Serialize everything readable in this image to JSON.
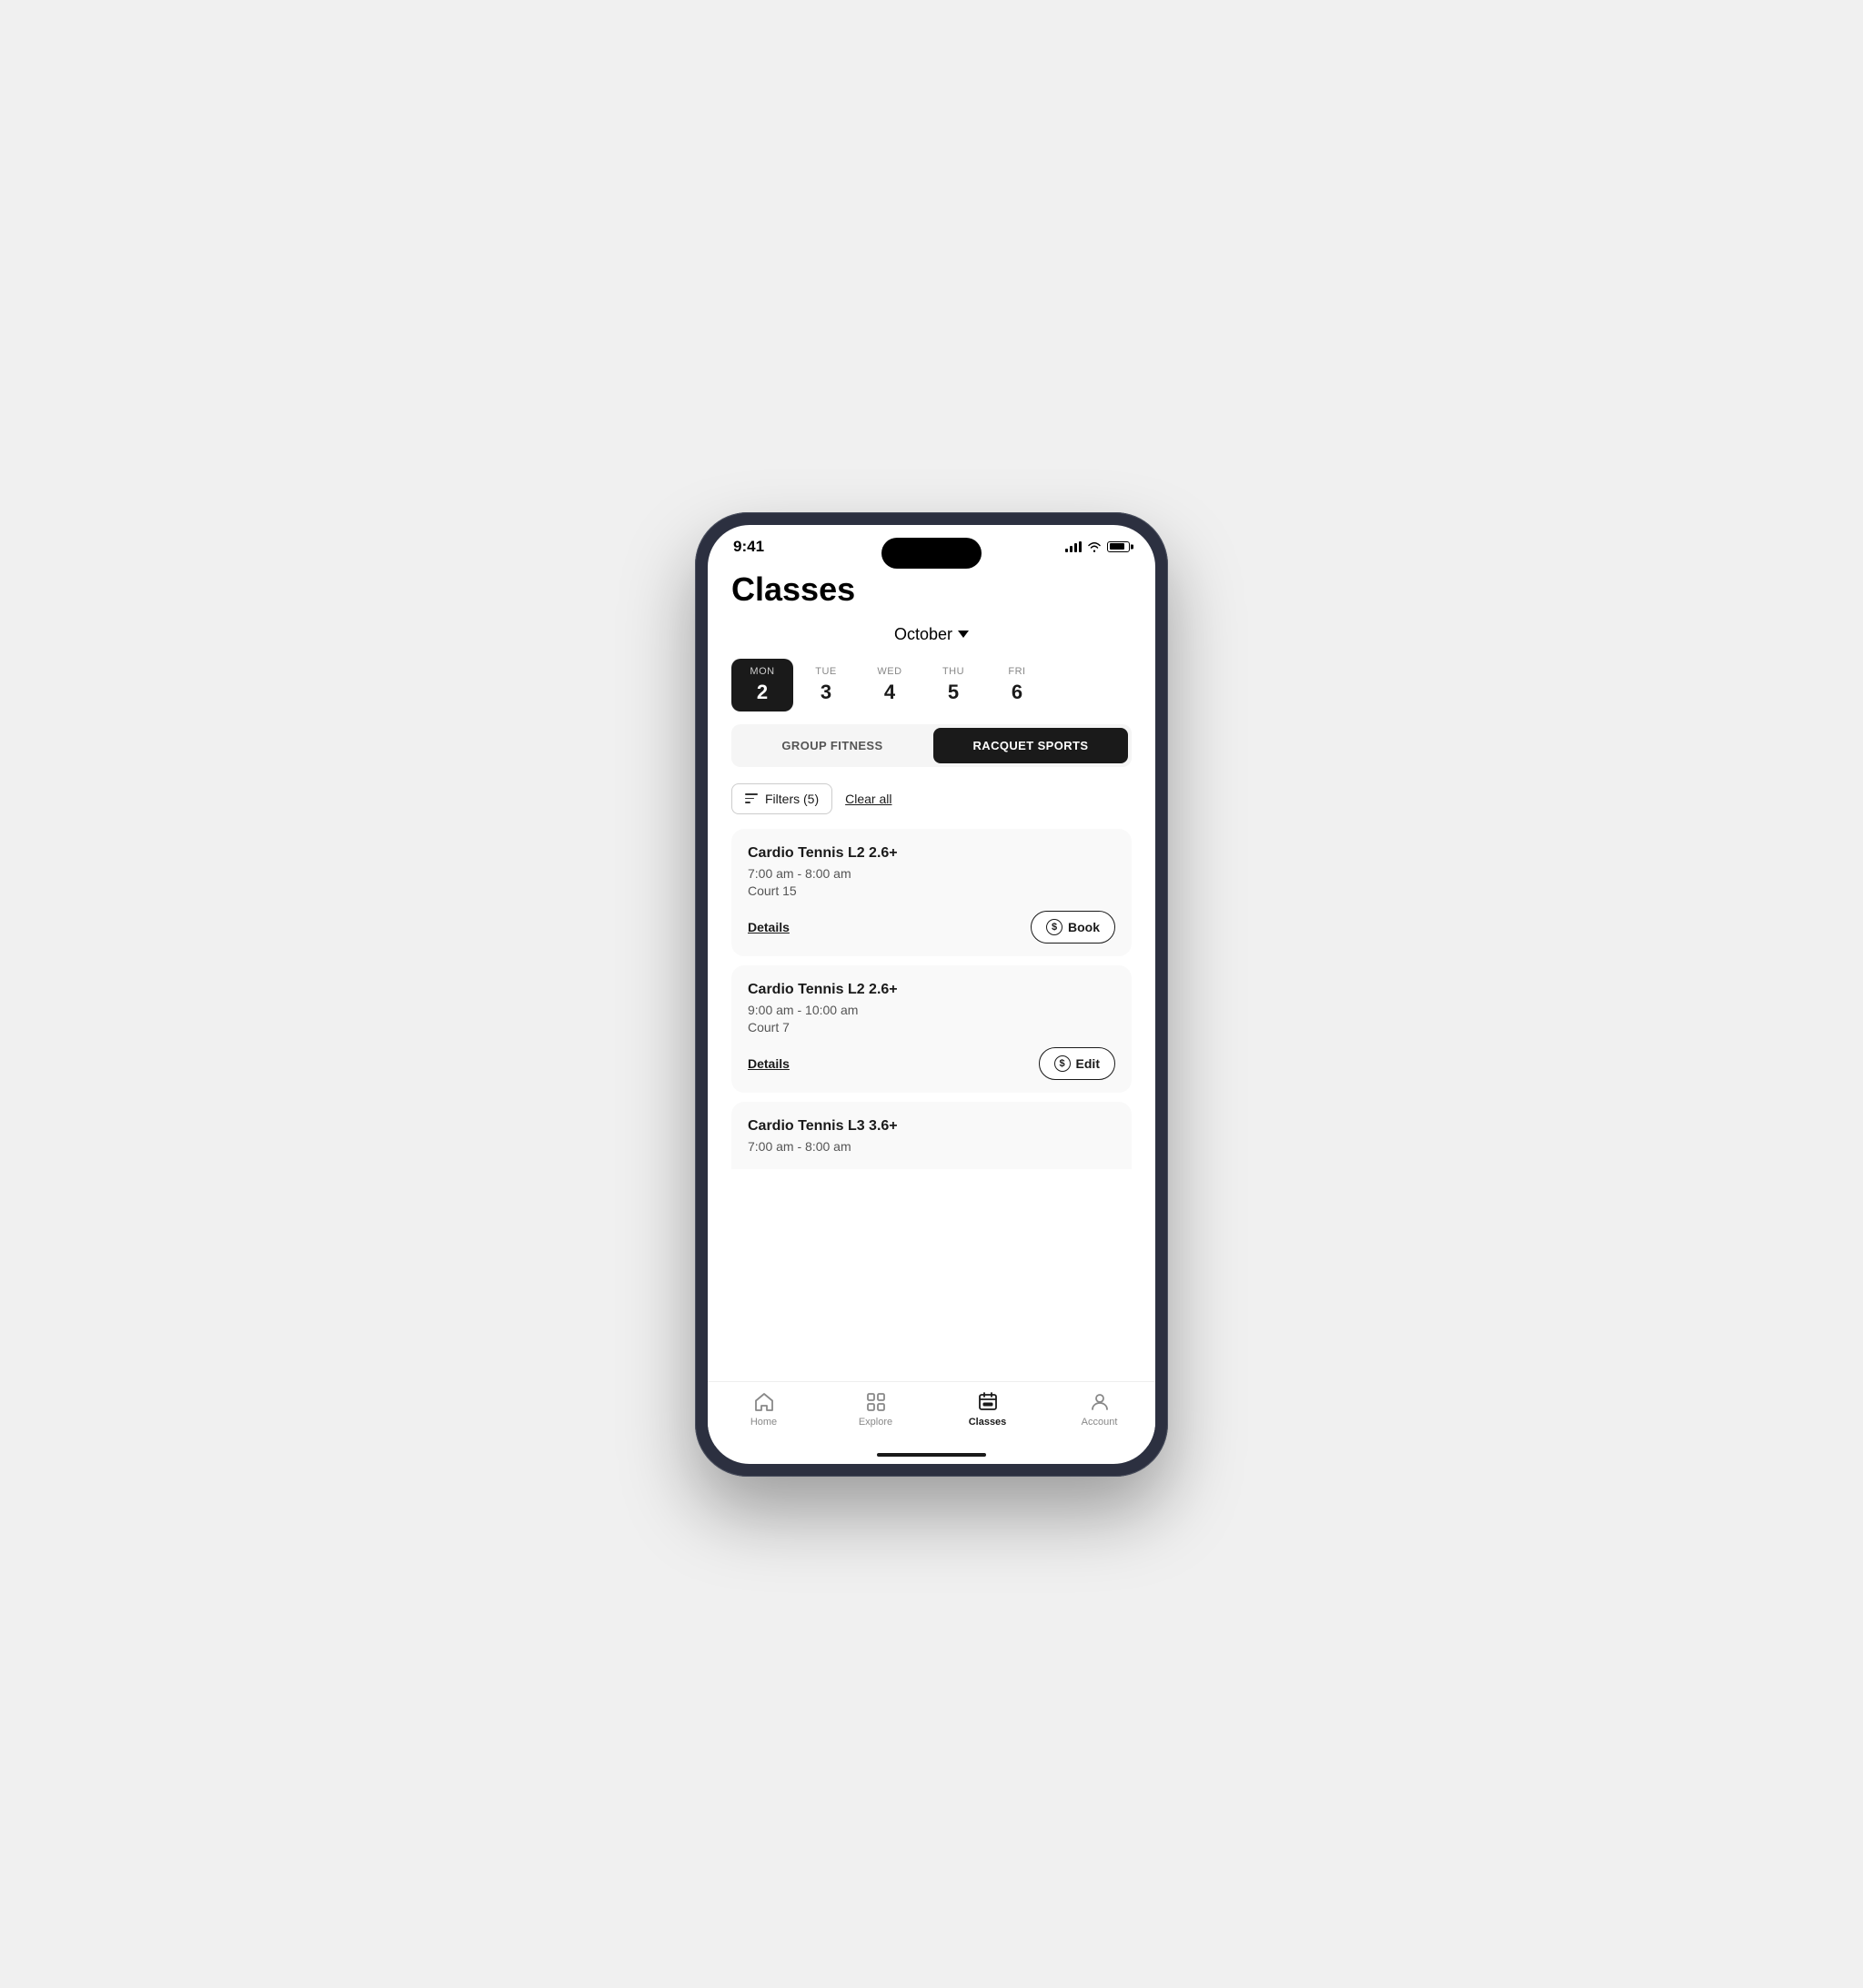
{
  "statusBar": {
    "time": "9:41"
  },
  "header": {
    "title": "Classes"
  },
  "monthSelector": {
    "month": "October",
    "chevron": "▾"
  },
  "weekDays": [
    {
      "label": "MON",
      "number": "2",
      "active": true
    },
    {
      "label": "TUE",
      "number": "3",
      "active": false
    },
    {
      "label": "WED",
      "number": "4",
      "active": false
    },
    {
      "label": "THU",
      "number": "5",
      "active": false
    },
    {
      "label": "FRI",
      "number": "6",
      "active": false
    }
  ],
  "tabs": [
    {
      "label": "GROUP FITNESS",
      "active": false
    },
    {
      "label": "RACQUET SPORTS",
      "active": true
    }
  ],
  "filters": {
    "label": "Filters (5)",
    "clearAll": "Clear all"
  },
  "classes": [
    {
      "name": "Cardio Tennis L2 2.6+",
      "time": "7:00 am - 8:00 am",
      "location": "Court 15",
      "detailsLabel": "Details",
      "actionLabel": "Book",
      "actionType": "book"
    },
    {
      "name": "Cardio Tennis L2 2.6+",
      "time": "9:00 am - 10:00 am",
      "location": "Court 7",
      "detailsLabel": "Details",
      "actionLabel": "Edit",
      "actionType": "edit"
    },
    {
      "name": "Cardio Tennis L3 3.6+",
      "time": "7:00 am - 8:00 am",
      "location": "",
      "detailsLabel": "",
      "actionLabel": "",
      "actionType": "partial"
    }
  ],
  "bottomNav": [
    {
      "label": "Home",
      "active": false,
      "icon": "home"
    },
    {
      "label": "Explore",
      "active": false,
      "icon": "explore"
    },
    {
      "label": "Classes",
      "active": true,
      "icon": "classes"
    },
    {
      "label": "Account",
      "active": false,
      "icon": "account"
    }
  ]
}
